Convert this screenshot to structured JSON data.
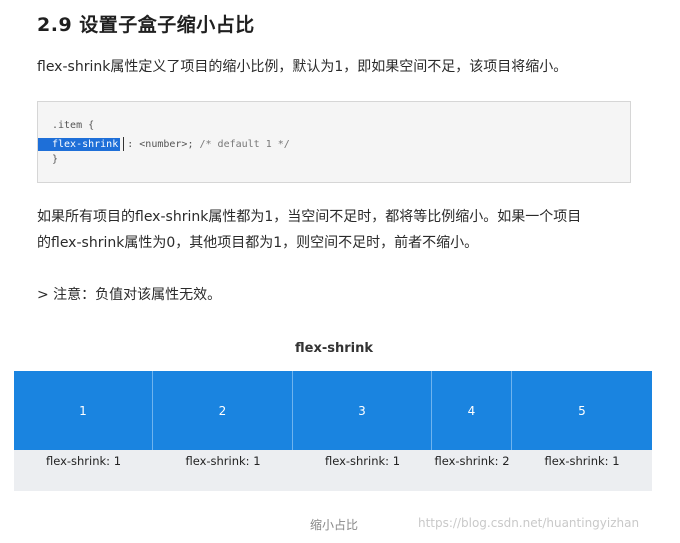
{
  "heading": "2.9 设置子盒子缩小占比",
  "intro": "flex-shrink属性定义了项目的缩小比例，默认为1，即如果空间不足，该项目将缩小。",
  "code": {
    "line1": ".item {",
    "selected": "flex-shrink",
    "rest": ": <number>; ",
    "comment": "/* default 1 */",
    "line3": "}"
  },
  "para2_line1": "如果所有项目的flex-shrink属性都为1，当空间不足时，都将等比例缩小。如果一个项目",
  "para2_line2": "的flex-shrink属性为0，其他项目都为1，则空间不足时，前者不缩小。",
  "note": "> 注意：负值对该属性无效。",
  "figure": {
    "title": "flex-shrink",
    "items": [
      {
        "number": "1",
        "label": "flex-shrink: 1"
      },
      {
        "number": "2",
        "label": "flex-shrink: 1"
      },
      {
        "number": "3",
        "label": "flex-shrink: 1"
      },
      {
        "number": "4",
        "label": "flex-shrink: 2"
      },
      {
        "number": "5",
        "label": "flex-shrink: 1"
      }
    ],
    "caption": "缩小占比"
  },
  "watermark": "https://blog.csdn.net/huantingyizhan",
  "colors": {
    "item_blue": "#1a84e0",
    "selection": "#1e6fd8"
  }
}
